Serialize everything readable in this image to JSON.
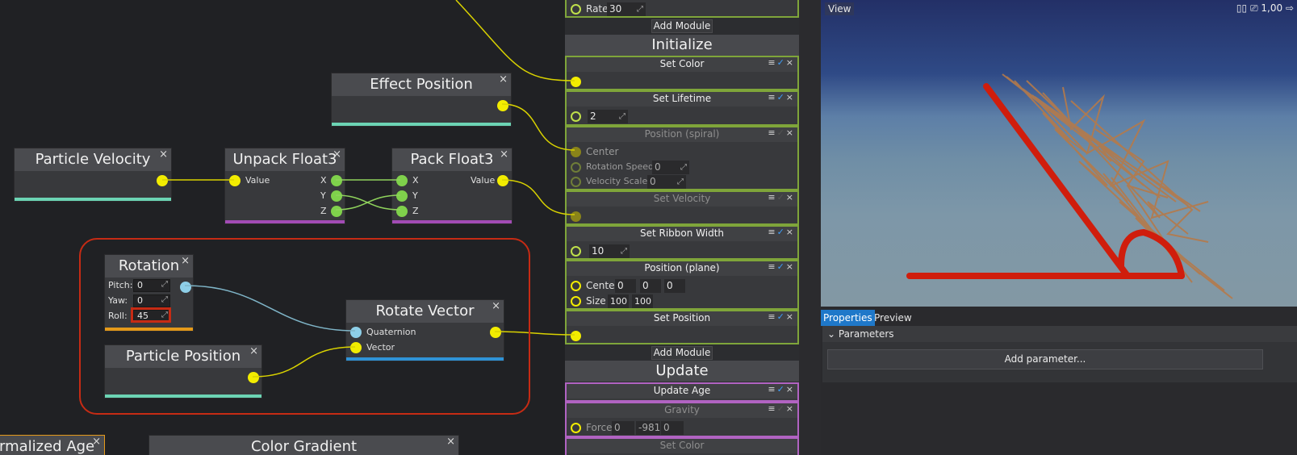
{
  "graph": {
    "nodes": {
      "effect_position": {
        "title": "Effect Position",
        "close": "×"
      },
      "particle_velocity": {
        "title": "Particle Velocity",
        "close": "×"
      },
      "unpack_float3": {
        "title": "Unpack Float3",
        "close": "×",
        "input": "Value",
        "outputs": [
          "X",
          "Y",
          "Z"
        ]
      },
      "pack_float3": {
        "title": "Pack Float3",
        "close": "×",
        "inputs": [
          "X",
          "Y",
          "Z"
        ],
        "output": "Value"
      },
      "rotation": {
        "title": "Rotation",
        "close": "×",
        "fields": [
          {
            "label": "Pitch:",
            "value": "0"
          },
          {
            "label": "Yaw:",
            "value": "0"
          },
          {
            "label": "Roll:",
            "value": "45"
          }
        ]
      },
      "rotate_vector": {
        "title": "Rotate Vector",
        "close": "×",
        "inputs": [
          "Quaternion",
          "Vector"
        ]
      },
      "particle_position": {
        "title": "Particle Position",
        "close": "×"
      },
      "normalized_age": {
        "title": "rmalized Age",
        "close": "×"
      },
      "color_gradient": {
        "title": "Color Gradient",
        "close": "×"
      }
    }
  },
  "modules": {
    "spawn_rate": {
      "label": "Rate",
      "value": "30"
    },
    "add_module_label": "Add Module",
    "sections": {
      "initialize": "Initialize",
      "update": "Update"
    },
    "initialize": {
      "set_color": {
        "title": "Set Color"
      },
      "set_lifetime": {
        "title": "Set Lifetime",
        "value": "2"
      },
      "position_spiral": {
        "title": "Position (spiral)",
        "center": "Center",
        "rotation_speed": "Rotation Speed",
        "rotation_speed_value": "0",
        "velocity_scale": "Velocity Scale",
        "velocity_scale_value": "0"
      },
      "set_velocity": {
        "title": "Set Velocity"
      },
      "set_ribbon_width": {
        "title": "Set Ribbon Width",
        "value": "10"
      },
      "position_plane": {
        "title": "Position (plane)",
        "center": "Center",
        "center_values": [
          "0",
          "0",
          "0"
        ],
        "size": "Size",
        "size_values": [
          "100",
          "100"
        ]
      },
      "set_position": {
        "title": "Set Position"
      }
    },
    "update": {
      "update_age": {
        "title": "Update Age"
      },
      "gravity": {
        "title": "Gravity",
        "force": "Force",
        "force_values": [
          "0",
          "-981",
          "0"
        ]
      },
      "set_color": {
        "title": "Set Color"
      }
    },
    "icons": {
      "menu": "≡",
      "check": "✓",
      "close": "×"
    }
  },
  "viewport": {
    "view_label": "View",
    "speed": "1,00"
  },
  "properties": {
    "tabs": [
      "Properties",
      "Preview"
    ],
    "group": "Parameters",
    "add_parameter": "Add parameter..."
  },
  "colors": {
    "accent": "#1f78c9",
    "highlight": "#c62b14",
    "float3_pin": "#f2ec00",
    "float_pin": "#7fd14b",
    "quat_pin": "#8ecfe8"
  }
}
